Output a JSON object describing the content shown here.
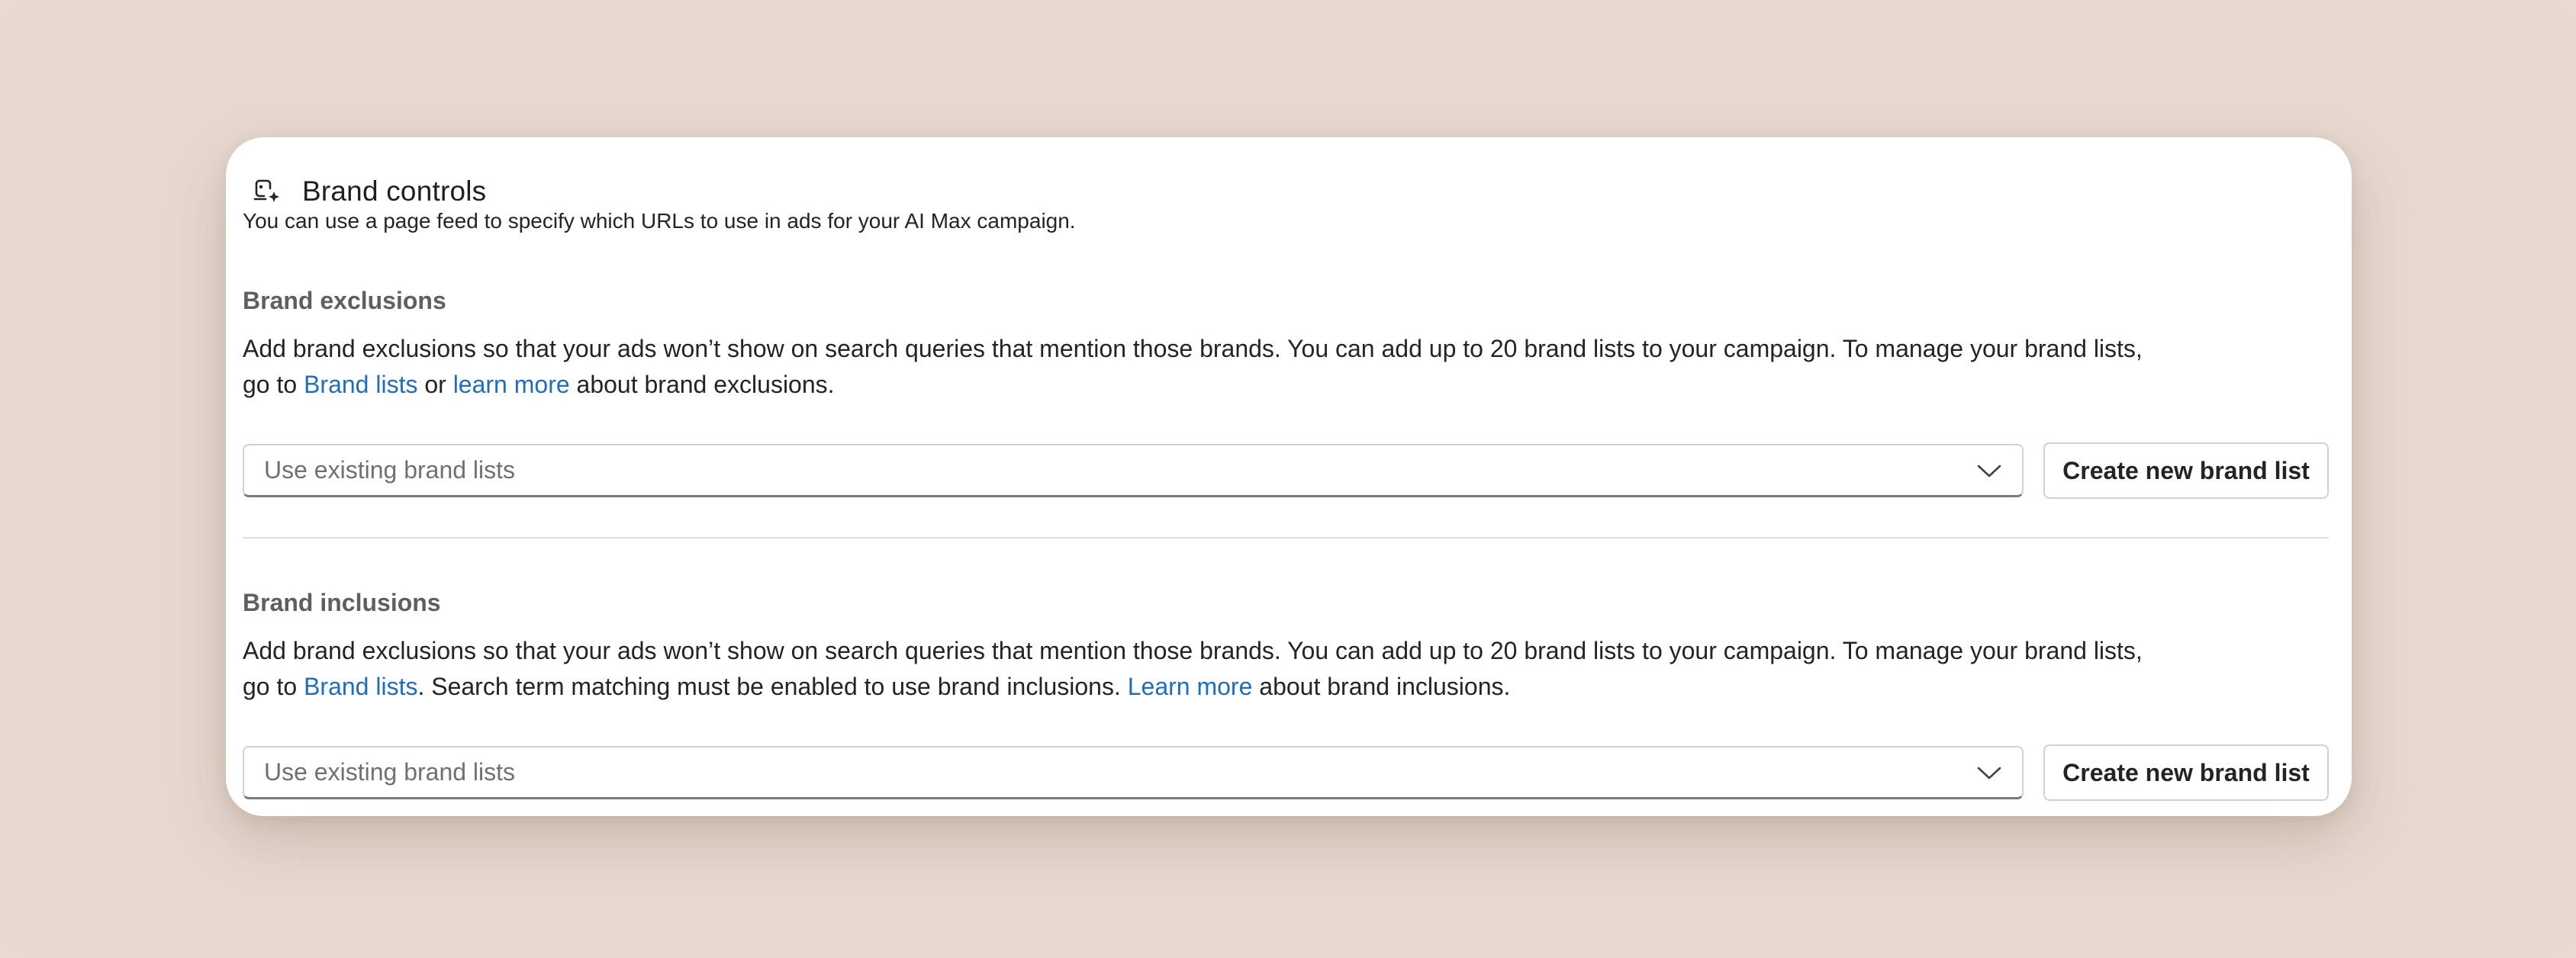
{
  "header": {
    "title": "Brand controls",
    "icon": "brand-tag-sparkle-icon"
  },
  "subtitle": "You can use a page feed to specify which URLs to use in ads for your AI Max campaign.",
  "exclusions": {
    "title": "Brand exclusions",
    "desc_line1": "Add brand exclusions so that your ads won’t show on search queries that mention those brands. You can add up to 20 brand lists to your campaign. To manage your brand lists,",
    "desc_prefix": "go to ",
    "link_brand_lists": "Brand lists",
    "desc_mid": " or ",
    "link_learn_more": "learn more",
    "desc_suffix": " about brand exclusions.",
    "select_placeholder": "Use existing brand lists",
    "button_label": "Create new brand list"
  },
  "inclusions": {
    "title": "Brand inclusions",
    "desc_line1": "Add brand exclusions so that your ads won’t show on search queries that mention those brands. You can add up to 20 brand lists to your campaign. To manage your brand lists,",
    "desc_prefix": "go to ",
    "link_brand_lists": "Brand lists",
    "desc_mid": ". Search term matching must be enabled to use brand inclusions. ",
    "link_learn_more": "Learn more",
    "desc_suffix": " about brand inclusions.",
    "select_placeholder": "Use existing brand lists",
    "button_label": "Create new brand list"
  },
  "colors": {
    "link": "#1d6dc2",
    "background": "#e6d9cf"
  }
}
